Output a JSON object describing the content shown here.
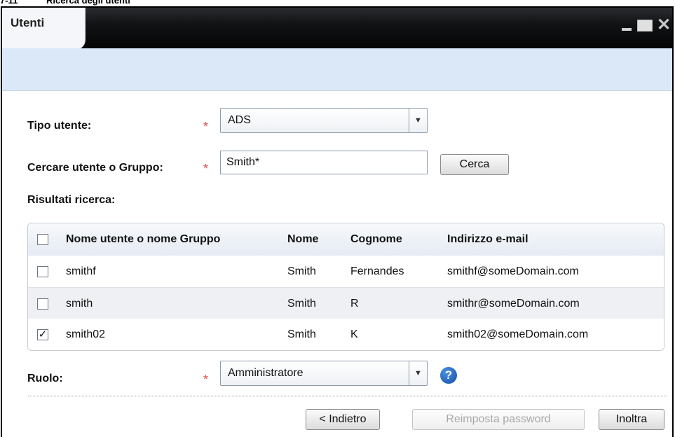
{
  "caption": {
    "number": "7-11",
    "text": "Ricerca degli utenti"
  },
  "window": {
    "tab_title": "Utenti",
    "controls": {
      "minimize_icon": "minimize-icon",
      "maximize_icon": "maximize-icon",
      "close_icon": "close-icon",
      "close_glyph": "✕"
    }
  },
  "form": {
    "user_type": {
      "label": "Tipo utente:",
      "required": "*",
      "value": "ADS"
    },
    "search": {
      "label": "Cercare utente o Gruppo:",
      "required": "*",
      "value": "Smith*",
      "button": "Cerca"
    },
    "results_label": "Risultati ricerca:",
    "role": {
      "label": "Ruolo:",
      "required": "*",
      "value": "Amministratore",
      "help": "?"
    }
  },
  "table": {
    "columns": [
      "Nome utente o nome Gruppo",
      "Nome",
      "Cognome",
      "Indirizzo e-mail"
    ],
    "rows": [
      {
        "checked": false,
        "username": "smithf",
        "first": "Smith",
        "last": "Fernandes",
        "email": "smithf@someDomain.com"
      },
      {
        "checked": false,
        "username": "smith",
        "first": "Smith",
        "last": "R",
        "email": "smithr@someDomain.com"
      },
      {
        "checked": true,
        "username": "smith02",
        "first": "Smith",
        "last": "K",
        "email": "smith02@someDomain.com"
      }
    ]
  },
  "footer": {
    "back": "< Indietro",
    "reset": "Reimposta password",
    "submit": "Inoltra"
  },
  "glyphs": {
    "check": "✓",
    "dropdown": "▼"
  }
}
